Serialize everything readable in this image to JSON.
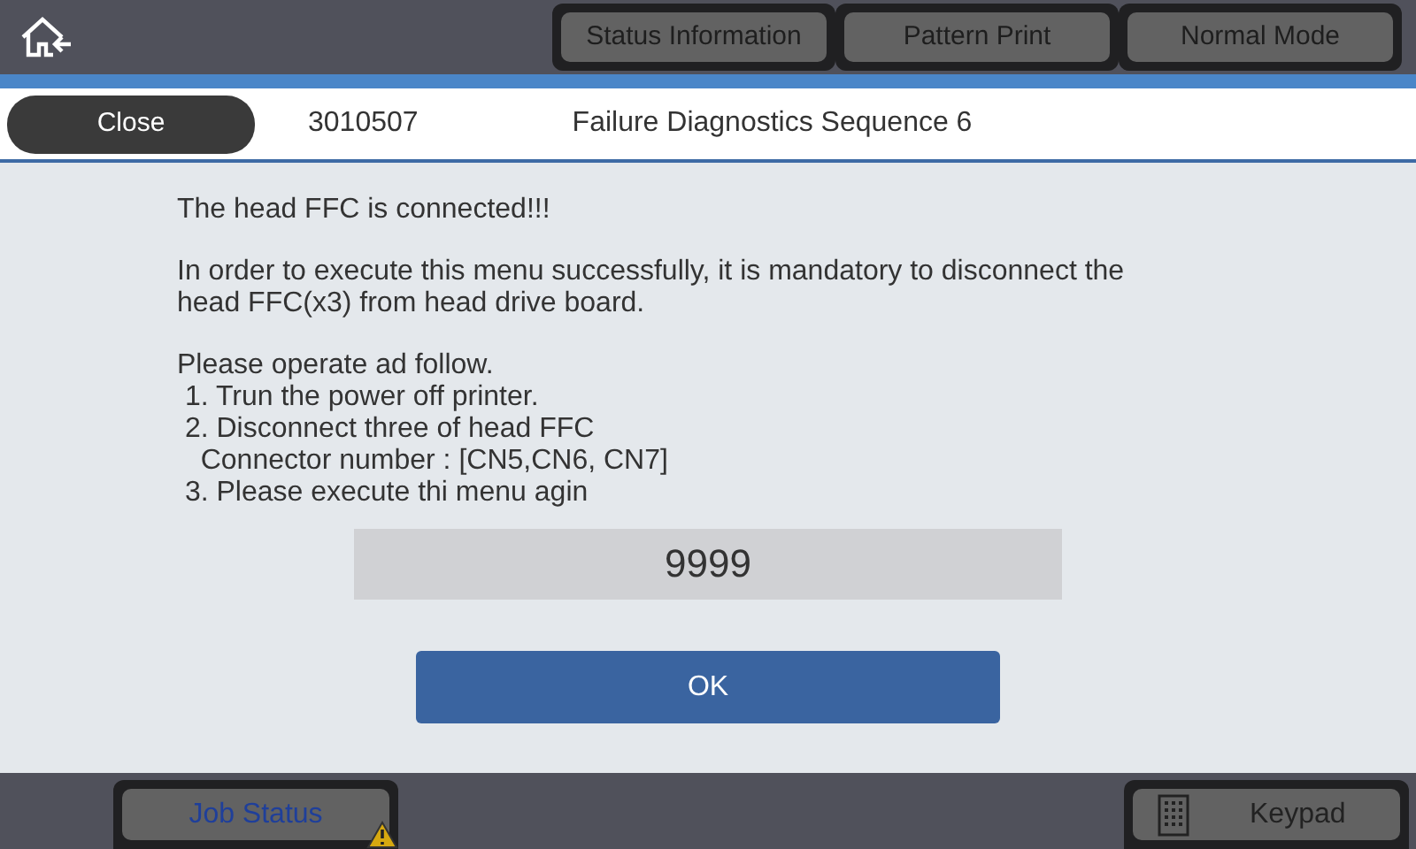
{
  "top_bar": {
    "buttons": [
      "Status Information",
      "Pattern Print",
      "Normal Mode"
    ]
  },
  "header": {
    "close_button": "Close",
    "code": "3010507",
    "title": "Failure Diagnostics Sequence 6"
  },
  "message": [
    [
      "The head FFC is connected!!!"
    ],
    [
      "In order to execute this menu successfully, it is mandatory to disconnect the",
      "head FFC(x3) from head drive board."
    ],
    [
      "Please operate ad follow.",
      " 1. Trun the power off printer.",
      " 2. Disconnect three of head FFC",
      "   Connector number : [CN5,CN6, CN7]",
      " 3. Please execute thi menu agin"
    ]
  ],
  "value_field": {
    "value": "9999"
  },
  "ok_button": "OK",
  "bottom_bar": {
    "job_status": {
      "label": "Job Status",
      "warning": true
    },
    "keypad": "Keypad"
  }
}
